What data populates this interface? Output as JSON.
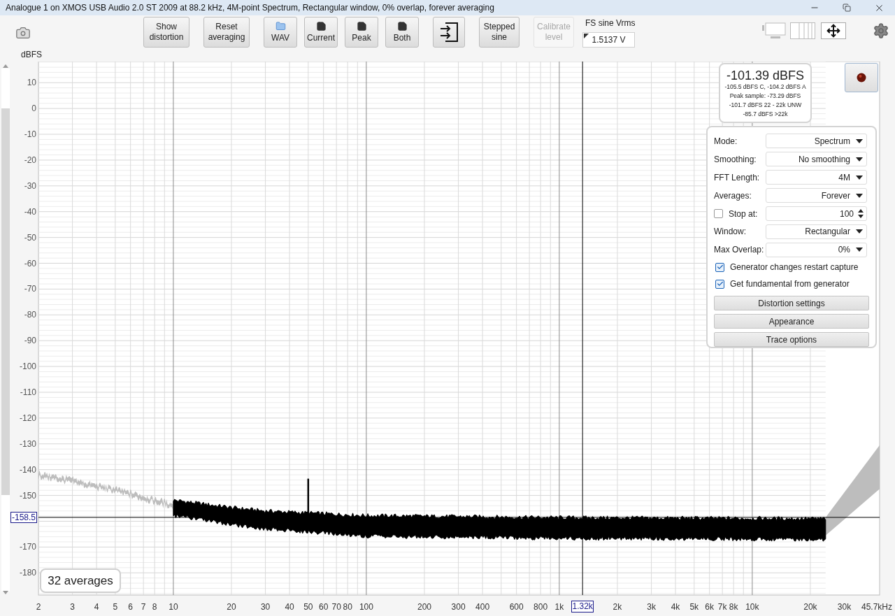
{
  "window": {
    "title": "Analogue 1 on XMOS USB Audio 2.0 ST 2009 at 88.2 kHz, 4M-point Spectrum, Rectangular window, 0% overlap, forever averaging"
  },
  "toolbar": {
    "buttons": [
      {
        "kind": "text",
        "label": "Show distortion",
        "disabled": false
      },
      {
        "kind": "text",
        "label": "Reset averaging",
        "disabled": false
      },
      {
        "kind": "folder",
        "label": "WAV",
        "disabled": false
      },
      {
        "kind": "save",
        "label": "Current",
        "disabled": false
      },
      {
        "kind": "save",
        "label": "Peak",
        "disabled": false
      },
      {
        "kind": "save",
        "label": "Both",
        "disabled": false
      },
      {
        "kind": "import",
        "disabled": false
      },
      {
        "kind": "text",
        "label": "Stepped sine",
        "disabled": false
      },
      {
        "kind": "text",
        "label": "Calibrate level",
        "disabled": true
      }
    ],
    "generator_level": {
      "label": "FS sine Vrms",
      "value": "1.5137 V"
    }
  },
  "axis_unit": "dBFS",
  "readout": {
    "value": "-101.39 dBFS",
    "lines": [
      "-105.5 dBFS C, -104.2 dBFS A",
      "Peak sample: -73.29 dBFS",
      "-101.7 dBFS 22 - 22k UNW",
      "-85.7 dBFS >22k"
    ]
  },
  "settings": {
    "rows": [
      {
        "kind": "select",
        "label": "Mode:",
        "value": "Spectrum"
      },
      {
        "kind": "select",
        "label": "Smoothing:",
        "value": "No smoothing"
      },
      {
        "kind": "select",
        "label": "FFT Length:",
        "value": "4M"
      },
      {
        "kind": "select",
        "label": "Averages:",
        "value": "Forever"
      },
      {
        "kind": "spin",
        "label": "Stop at:",
        "value": "100",
        "checked": false
      },
      {
        "kind": "select",
        "label": "Window:",
        "value": "Rectangular"
      },
      {
        "kind": "select",
        "label": "Max Overlap:",
        "value": "0%"
      }
    ],
    "options": [
      {
        "label": "Generator changes restart capture",
        "checked": true
      },
      {
        "label": "Get fundamental from generator",
        "checked": true
      }
    ],
    "buttons": [
      "Distortion settings",
      "Appearance",
      "Trace options"
    ]
  },
  "averages_badge": "32 averages",
  "plot": {
    "y_labels": [
      "10",
      "0",
      "-10",
      "-20",
      "-30",
      "-40",
      "-50",
      "-60",
      "-70",
      "-80",
      "-90",
      "-100",
      "-110",
      "-120",
      "-130",
      "-140",
      "-150",
      "-170",
      "-180"
    ],
    "x_labels": [
      "2",
      "3",
      "4",
      "5",
      "6",
      "7",
      "8",
      "10",
      "20",
      "30",
      "40",
      "50",
      "60",
      "70",
      "80",
      "100",
      "200",
      "300",
      "400",
      "600",
      "800",
      "1k",
      "2k",
      "3k",
      "4k",
      "5k",
      "6k",
      "7k",
      "8k",
      "10k",
      "20k",
      "30k",
      "45.7kHz"
    ],
    "cursor": {
      "level": "-158.5",
      "frequency": "1.32k"
    }
  }
}
